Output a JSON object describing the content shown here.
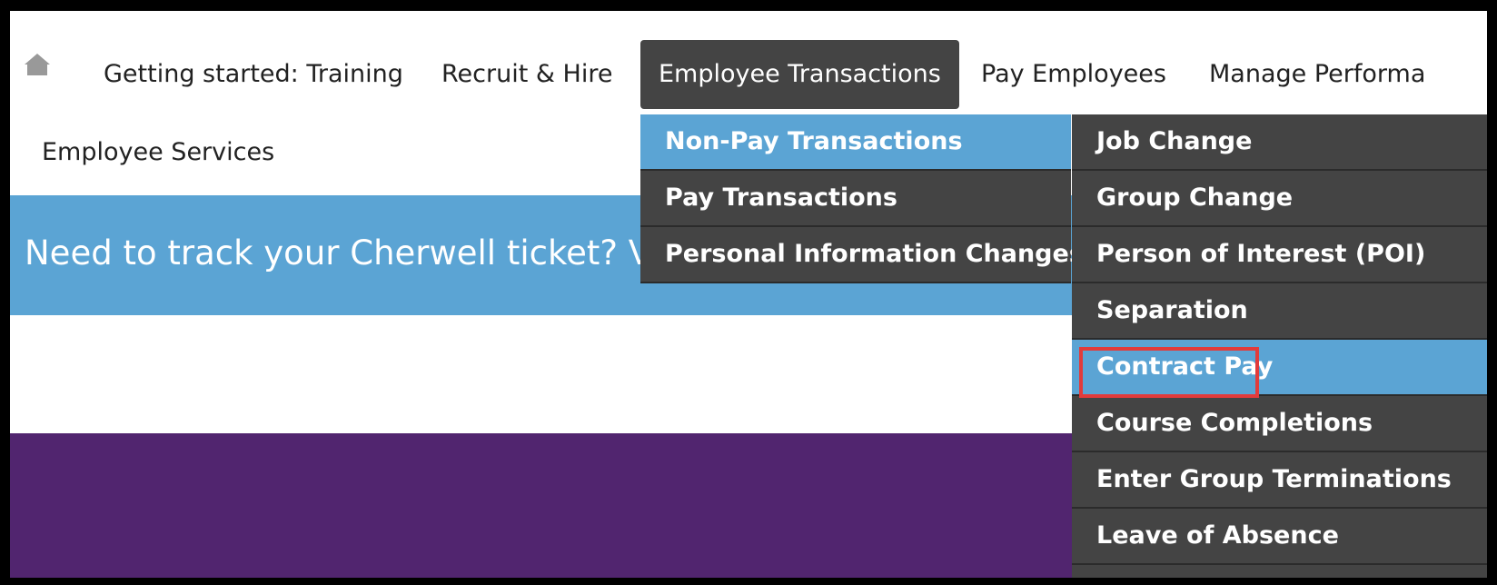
{
  "nav": {
    "items": [
      {
        "label": "Getting started: Training"
      },
      {
        "label": "Recruit & Hire"
      },
      {
        "label": "Employee Transactions",
        "active": true
      },
      {
        "label": "Pay Employees"
      },
      {
        "label": "Manage Performa"
      }
    ],
    "second_row": "Employee Services"
  },
  "banner": {
    "text": "Need to track your Cherwell ticket? Visit"
  },
  "submenu1": {
    "items": [
      {
        "label": "Non-Pay Transactions",
        "selected": true
      },
      {
        "label": "Pay Transactions"
      },
      {
        "label": "Personal Information Changes"
      }
    ]
  },
  "submenu2": {
    "items": [
      {
        "label": "Job Change"
      },
      {
        "label": "Group Change"
      },
      {
        "label": "Person of Interest (POI)"
      },
      {
        "label": "Separation"
      },
      {
        "label": "Contract Pay",
        "selected": true,
        "highlighted": true
      },
      {
        "label": "Course Completions"
      },
      {
        "label": "Enter Group Terminations"
      },
      {
        "label": "Leave of Absence"
      }
    ]
  },
  "colors": {
    "menu_bg": "#444444",
    "selected_bg": "#5ba4d4",
    "purple_band": "#51256f",
    "highlight_border": "#e23b3b"
  }
}
